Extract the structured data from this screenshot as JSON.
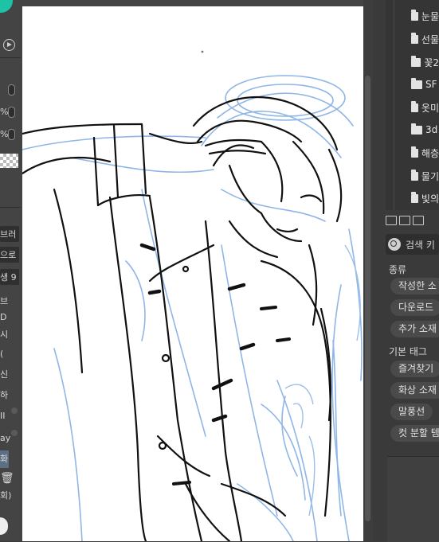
{
  "left_panel": {
    "percent_1": "%",
    "percent_2": "%",
    "labels": [
      "브러",
      "으로",
      "생 9",
      "브",
      "D",
      "시",
      "(",
      "신",
      "하",
      "II",
      "ay",
      "화",
      "회)"
    ]
  },
  "folders": [
    "눈물",
    "선물",
    "꽃2",
    "SF",
    "옷미",
    "3d",
    "해층",
    "물기",
    "빛의"
  ],
  "search": {
    "label": "검색 키"
  },
  "material_panel": {
    "kind_label": "종류",
    "kind_buttons": [
      "작성한 소",
      "다운로드",
      "추가 소재"
    ],
    "basic_tag_label": "기본 태그",
    "tag_buttons": [
      "즐겨찾기",
      "화상 소재",
      "말풍선",
      "컷 분할 템"
    ]
  }
}
